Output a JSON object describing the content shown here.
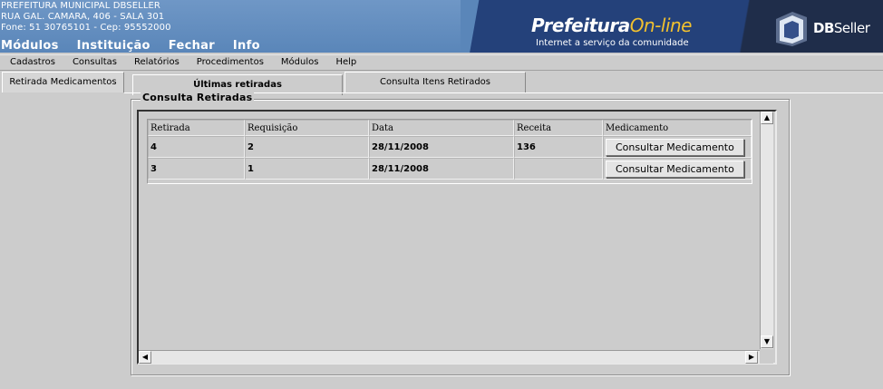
{
  "header": {
    "org_name": "PREFEITURA MUNICIPAL DBSELLER",
    "org_address": "RUA GAL. CAMARA, 406 - SALA 301",
    "org_phone": "Fone: 51 30765101  -  Cep: 95552000",
    "brand_title_main": "Prefeitura",
    "brand_title_highlight": "On-line",
    "brand_subtitle": "Internet a serviço da comunidade",
    "dbseller_logo_bold": "DB",
    "dbseller_logo_light": "Seller",
    "top_menu": [
      "Módulos",
      "Instituição",
      "Fechar",
      "Info"
    ]
  },
  "menubar": [
    "Cadastros",
    "Consultas",
    "Relatórios",
    "Procedimentos",
    "Módulos",
    "Help"
  ],
  "tabs": {
    "retirada": "Retirada Medicamentos",
    "ultimas": "Últimas retiradas",
    "consulta_itens": "Consulta Itens Retirados"
  },
  "fieldset": {
    "legend": "Consulta Retiradas"
  },
  "grid": {
    "columns": [
      "Retirada",
      "Requisição",
      "Data",
      "Receita",
      "Medicamento"
    ],
    "rows": [
      {
        "retirada": "4",
        "requisicao": "2",
        "data": "28/11/2008",
        "receita": "136",
        "button": "Consultar Medicamento"
      },
      {
        "retirada": "3",
        "requisicao": "1",
        "data": "28/11/2008",
        "receita": "",
        "button": "Consultar Medicamento"
      }
    ]
  },
  "scrollbar": {
    "up": "▲",
    "down": "▼",
    "left": "◀",
    "right": "▶"
  },
  "colors": {
    "header_blue": "#5b86b8",
    "brand_navy": "#24417a",
    "brand_yellow": "#f2c12e",
    "background": "#cccccc"
  }
}
